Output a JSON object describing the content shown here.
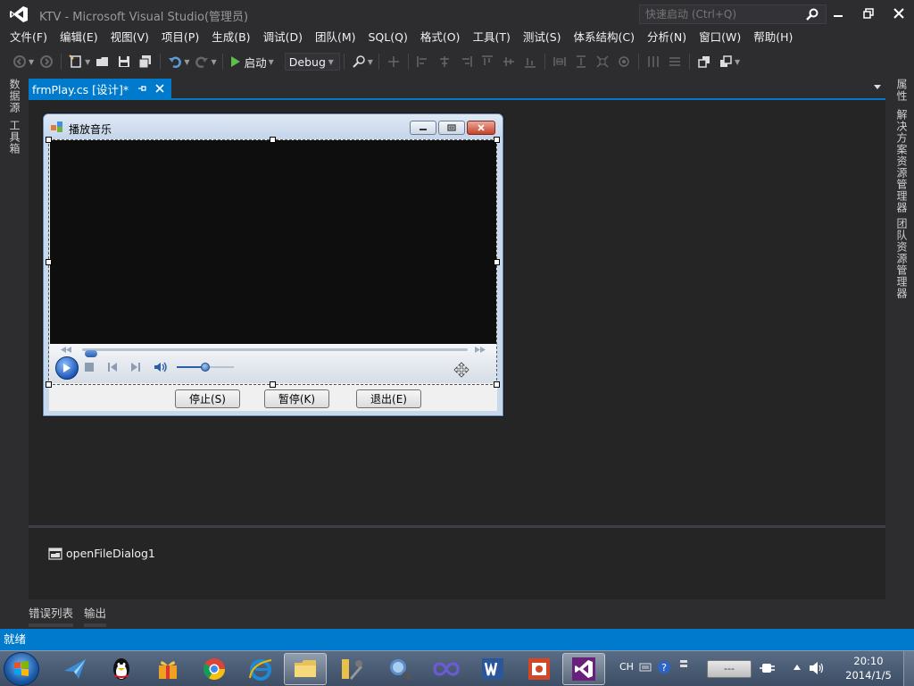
{
  "window": {
    "title": "KTV - Microsoft Visual Studio(管理员)",
    "quick_launch_placeholder": "快速启动 (Ctrl+Q)"
  },
  "menu": [
    "文件(F)",
    "编辑(E)",
    "视图(V)",
    "项目(P)",
    "生成(B)",
    "调试(D)",
    "团队(M)",
    "SQL(Q)",
    "格式(O)",
    "工具(T)",
    "测试(S)",
    "体系结构(C)",
    "分析(N)",
    "窗口(W)",
    "帮助(H)"
  ],
  "toolbar": {
    "start_label": "启动",
    "configuration": "Debug"
  },
  "left_tabs": [
    "数据源",
    "工具箱"
  ],
  "right_tabs": [
    "属性",
    "解决方案资源管理器",
    "团队资源管理器"
  ],
  "document_tab": {
    "label": "frmPlay.cs [设计]*"
  },
  "form": {
    "title": "播放音乐",
    "buttons": {
      "stop": "停止(S)",
      "pause": "暂停(K)",
      "exit": "退出(E)"
    }
  },
  "player": {
    "seek_fraction": 0.02,
    "volume_fraction": 0.5
  },
  "component_tray": {
    "component": "openFileDialog1"
  },
  "bottom_tabs": [
    "错误列表",
    "输出"
  ],
  "status": {
    "text": "就绪"
  },
  "taskbar": {
    "lang": "CH",
    "network_text": "---",
    "time": "20:10",
    "date": "2014/1/5"
  },
  "colors": {
    "accent": "#007acc",
    "background": "#2d2d30",
    "designer": "#252526"
  }
}
